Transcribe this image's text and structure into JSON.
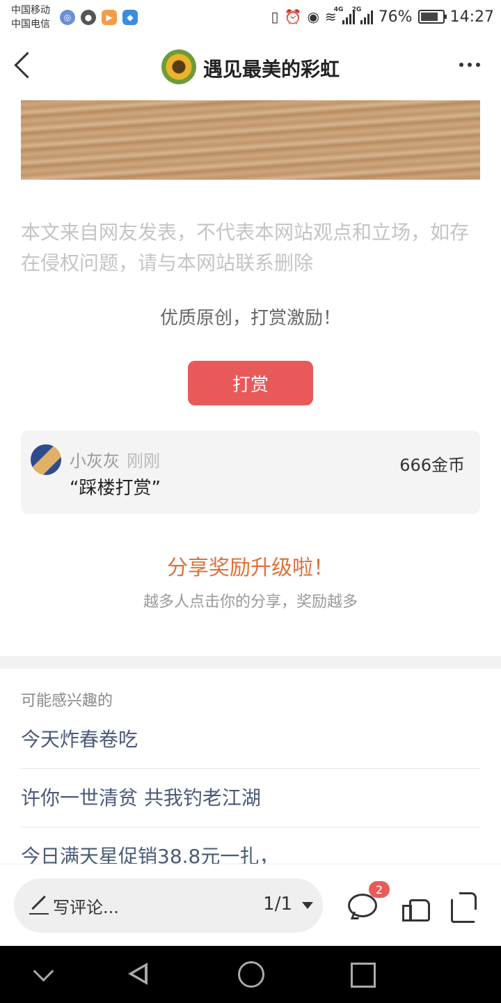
{
  "status_bar": {
    "carrier1": "中国移动",
    "carrier2": "中国电信",
    "net1": "4G",
    "net2": "2G",
    "battery_percent": "76%",
    "time": "14:27",
    "notification_icons": [
      "browser-icon",
      "chat-icon",
      "video-icon",
      "shield-icon"
    ]
  },
  "header": {
    "title": "遇见最美的彩虹",
    "avatar_icon": "sunflower-avatar",
    "more_icon": "more-dots-icon"
  },
  "article": {
    "disclaimer": "本文来自网友发表，不代表本网站观点和立场，如存在侵权问题，请与本网站联系删除",
    "reward_prompt": "优质原创，打赏激励！",
    "reward_button": "打赏"
  },
  "tip": {
    "user": "小灰灰",
    "time": "刚刚",
    "message": "“踩楼打赏”",
    "amount": "666金币"
  },
  "share": {
    "title": "分享奖励升级啦！",
    "subtitle": "越多人点击你的分享，奖励越多"
  },
  "recommend": {
    "title": "可能感兴趣的",
    "items": [
      "今天炸春卷吃",
      "许你一世清贫 共我钓老江湖",
      "今日满天星促销38.8元一扎，"
    ]
  },
  "bottom_bar": {
    "comment_placeholder": "写评论...",
    "page_indicator": "1/1",
    "comment_count": "2"
  },
  "colors": {
    "accent_red": "#e85a5a",
    "share_orange": "#e0703a",
    "link_blue": "#4a5a78"
  }
}
